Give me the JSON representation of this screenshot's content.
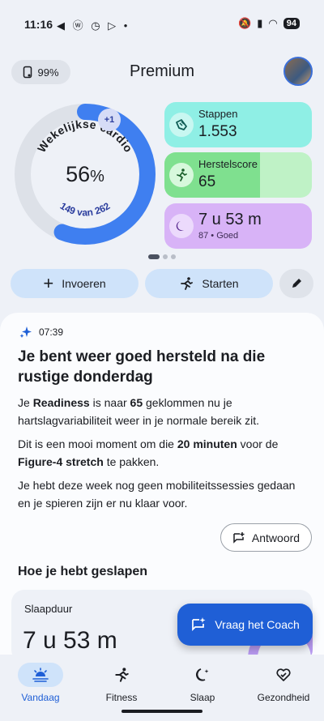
{
  "status_bar": {
    "time": "11:16",
    "app_icons": "◀ ⓦ ◷ ▷ •",
    "battery": "94",
    "colors": {
      "text": "#1b1d22"
    }
  },
  "header": {
    "device_battery": "99%",
    "title": "Premium"
  },
  "cardio": {
    "label": "Wekelijkse cardio",
    "percent": "56",
    "percent_symbol": "%",
    "progress_text": "149 van 262",
    "badge": "+1",
    "progress_fraction": 0.56,
    "colors": {
      "ring": "#3f7ff0",
      "track": "#dde1e8"
    }
  },
  "metrics": {
    "steps": {
      "label": "Stappen",
      "value": "1.553",
      "icon": "shoe-icon",
      "color": "#8fefe5"
    },
    "recovery": {
      "label": "Herstelscore",
      "value": "65",
      "fill_fraction": 0.65,
      "icon": "running-figure-icon",
      "color": "#7fe08f"
    },
    "sleep": {
      "value": "7 u 53 m",
      "sub": "87 • Goed",
      "icon": "moon-icon",
      "color": "#d8b3f7"
    }
  },
  "actions": {
    "enter_label": "Invoeren",
    "start_label": "Starten"
  },
  "insight": {
    "time": "07:39",
    "title": "Je bent weer goed hersteld na die rustige donderdag",
    "p1_pre": "Je ",
    "p1_bold1": "Readiness",
    "p1_mid": " is naar ",
    "p1_bold2": "65",
    "p1_post": " geklommen nu je hartslagvariabiliteit weer in je normale bereik zit.",
    "p2_pre": "Dit is een mooi moment om die ",
    "p2_bold1": "20 minuten",
    "p2_mid": " voor de ",
    "p2_bold2": "Figure-4 stretch",
    "p2_post": " te pakken.",
    "p3": "Je hebt deze week nog geen mobiliteitssessies gedaan en je spieren zijn er nu klaar voor.",
    "reply_label": "Antwoord"
  },
  "sleep_section": {
    "title": "Hoe je hebt geslapen",
    "card_label": "Slaapduur",
    "card_value": "7 u 53 m"
  },
  "coach": {
    "label": "Vraag het Coach",
    "color": "#1f5fd6"
  },
  "nav": {
    "items": [
      {
        "label": "Vandaag",
        "icon": "sun-horizon-icon",
        "active": true
      },
      {
        "label": "Fitness",
        "icon": "running-figure-icon",
        "active": false
      },
      {
        "label": "Slaap",
        "icon": "moon-icon",
        "active": false
      },
      {
        "label": "Gezondheid",
        "icon": "heart-check-icon",
        "active": false
      }
    ]
  }
}
